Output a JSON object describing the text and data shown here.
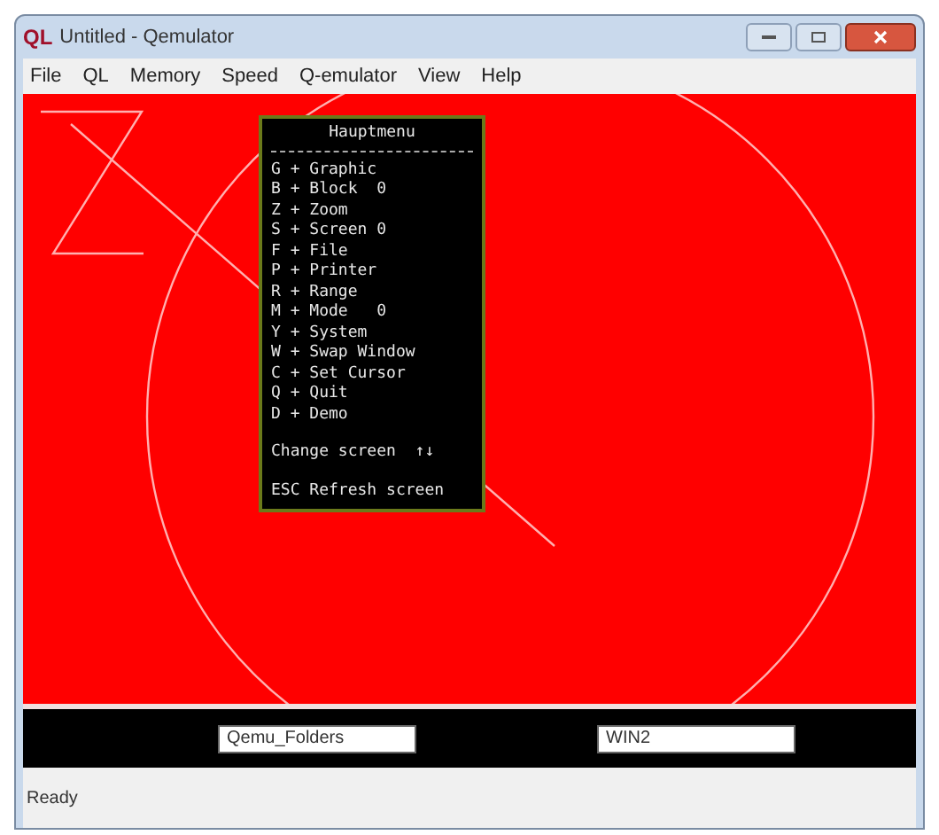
{
  "window": {
    "logo": "QL",
    "title": "Untitled - Qemulator"
  },
  "menu_bar": [
    "File",
    "QL",
    "Memory",
    "Speed",
    "Q-emulator",
    "View",
    "Help"
  ],
  "main_menu": {
    "title": "Hauptmenu",
    "items": [
      "G + Graphic",
      "B + Block  0",
      "Z + Zoom",
      "S + Screen 0",
      "F + File",
      "P + Printer",
      "R + Range",
      "M + Mode   0",
      "Y + System",
      "W + Swap Window",
      "C + Set Cursor",
      "Q + Quit",
      "D + Demo"
    ],
    "change_screen": "Change screen  ↑↓",
    "refresh": "ESC Refresh screen"
  },
  "drives": [
    {
      "value": "Qemu_Folders"
    },
    {
      "value": "WIN2"
    }
  ],
  "status_bar": "Ready"
}
